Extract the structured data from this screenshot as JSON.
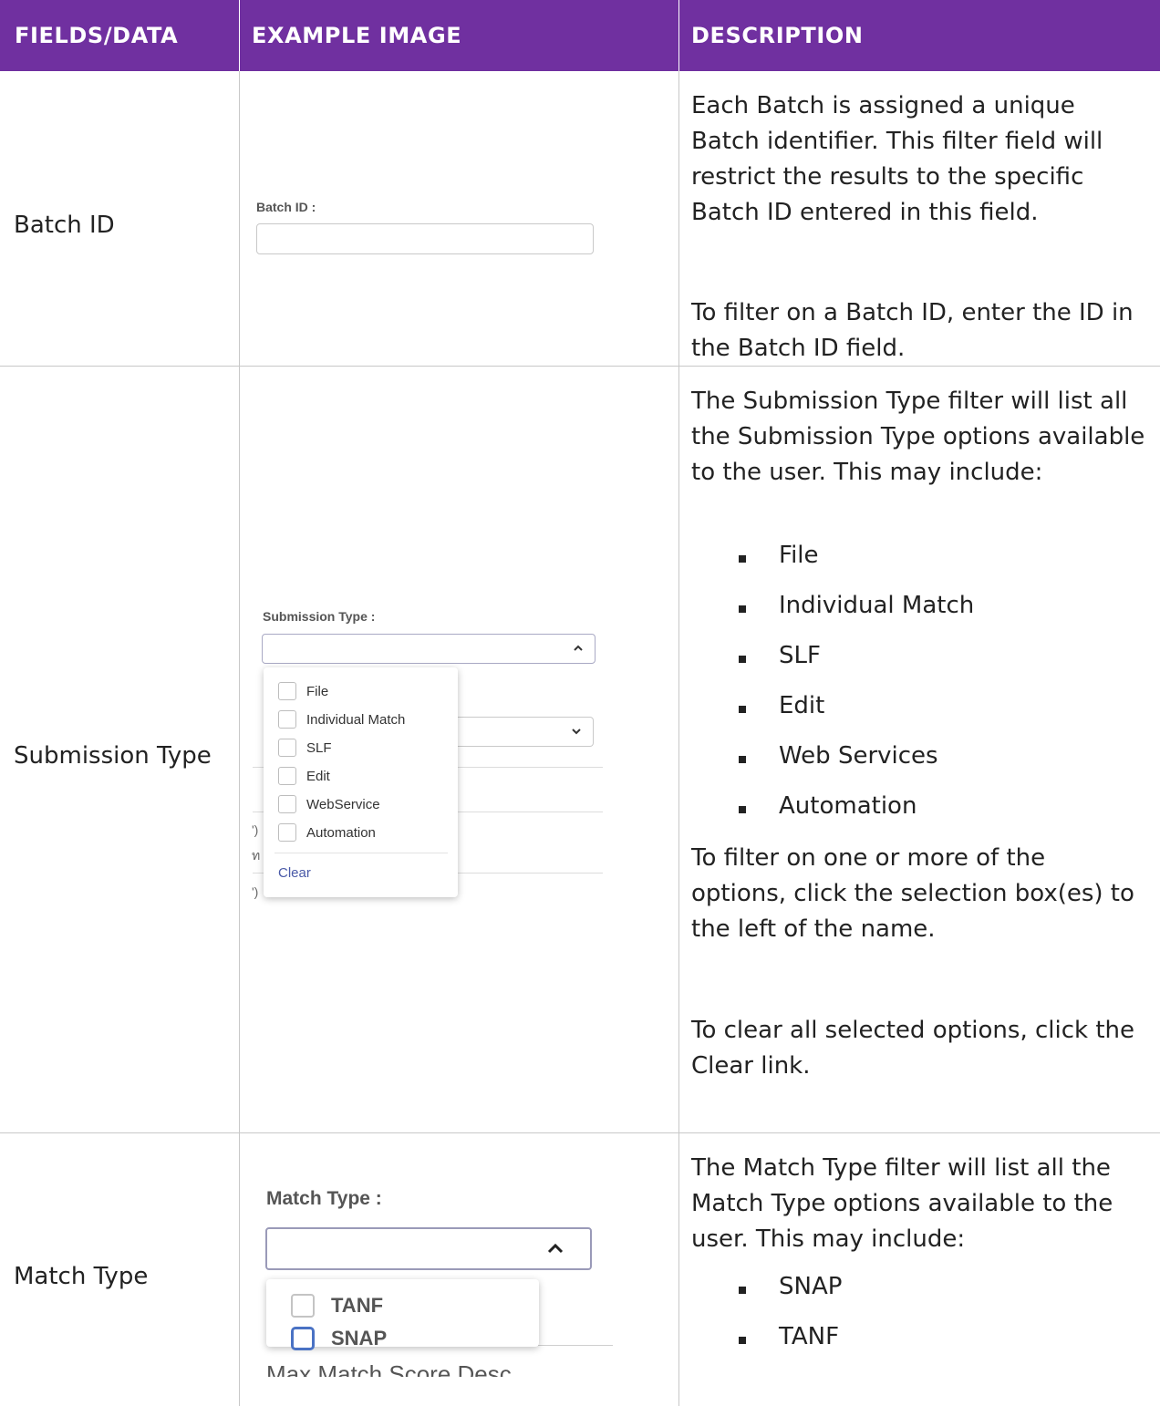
{
  "header": {
    "col1": "FIELDS/DATA",
    "col2": "EXAMPLE IMAGE",
    "col3": "DESCRIPTION"
  },
  "colors": {
    "header_bg": "#7030a0",
    "header_text": "#ffffff",
    "link": "#4a5aa8"
  },
  "rows": [
    {
      "field": "Batch ID",
      "example": {
        "label": "Batch ID :",
        "value": ""
      },
      "description": [
        "Each Batch is assigned a unique Batch identifier. This filter field will restrict the results to the specific Batch ID entered in this field.",
        "To filter on a Batch ID, enter the ID in the Batch ID field."
      ]
    },
    {
      "field": "Submission Type",
      "example": {
        "label": "Submission Type :",
        "options": [
          "File",
          "Individual Match",
          "SLF",
          "Edit",
          "WebService",
          "Automation"
        ],
        "clear_label": "Clear",
        "bg_fragments": [
          "')",
          "ท",
          "')"
        ]
      },
      "description": {
        "intro": "The Submission Type filter will list all the Submission Type options available to the user. This may include:",
        "items": [
          "File",
          "Individual Match",
          "SLF",
          "Edit",
          "Web Services",
          "Automation"
        ],
        "para2": "To filter on one or more of the options, click the selection box(es) to the left of the name.",
        "para3": "To clear all selected options, click the Clear link."
      }
    },
    {
      "field": "Match Type",
      "example": {
        "label": "Match Type :",
        "options": [
          "TANF",
          "SNAP"
        ],
        "bg_fragment": "Max Match Score Desc"
      },
      "description": {
        "intro": "The Match Type filter will list all the Match Type options available to the user. This may include:",
        "items": [
          "SNAP",
          "TANF"
        ]
      }
    }
  ]
}
